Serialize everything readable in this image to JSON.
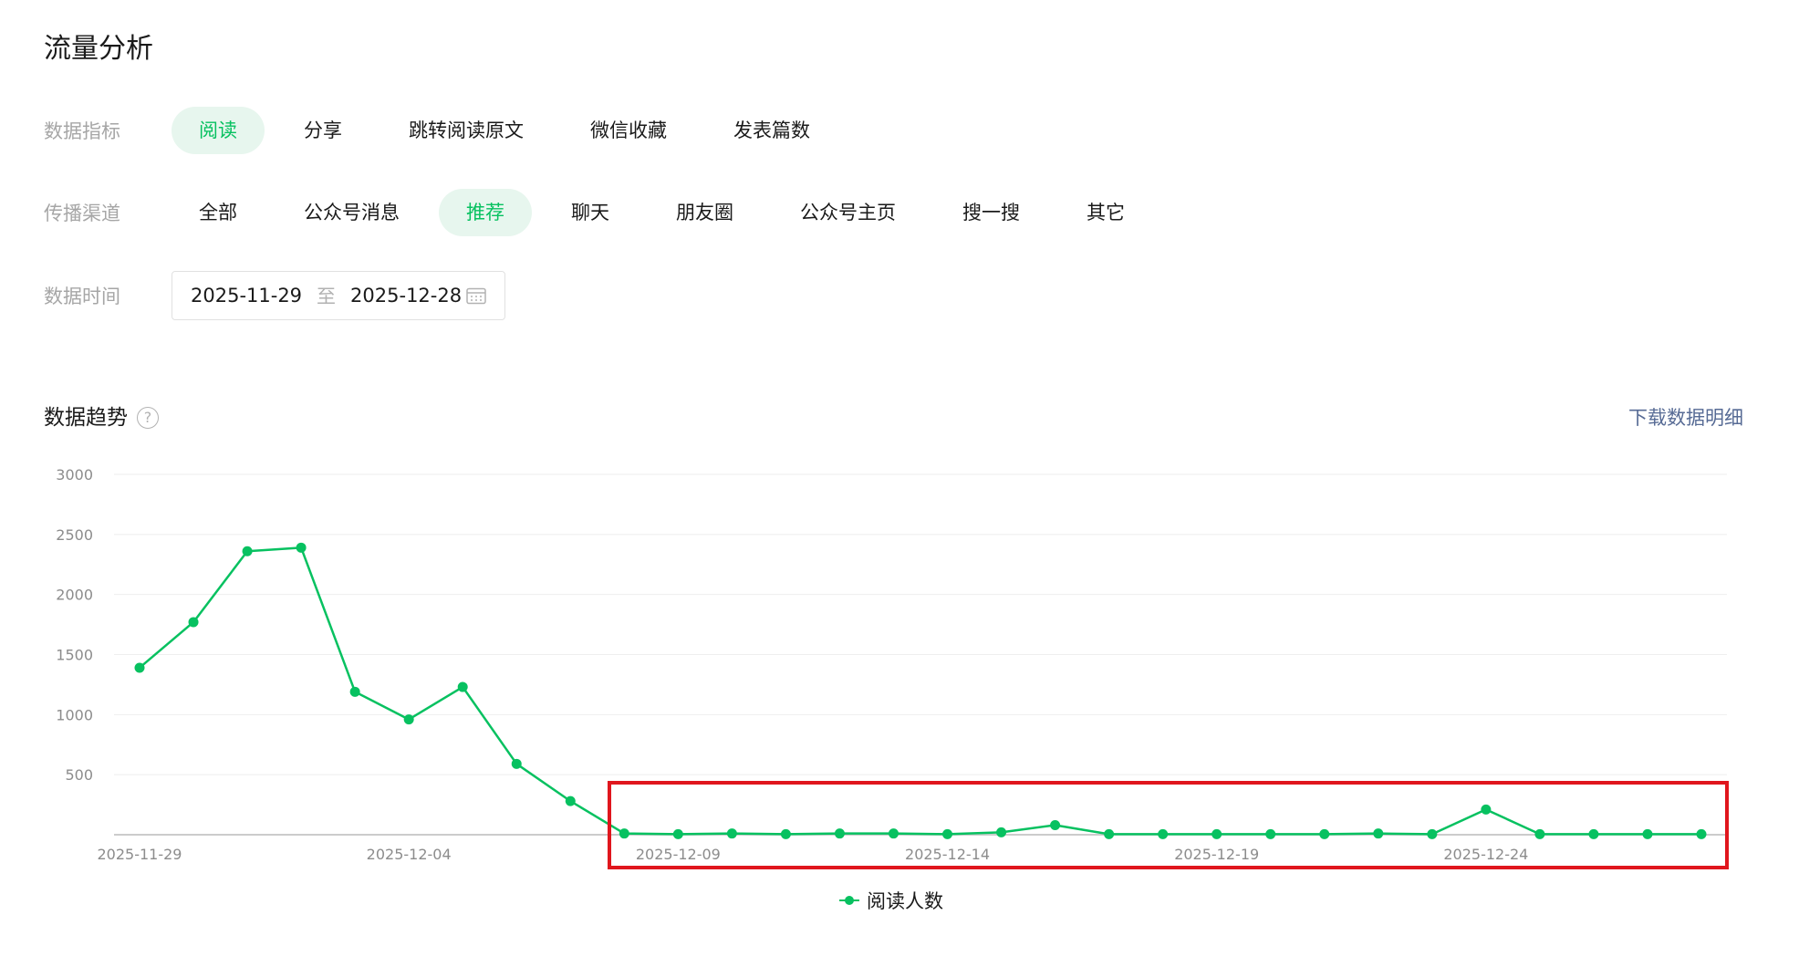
{
  "page": {
    "title": "流量分析"
  },
  "filters": {
    "metric": {
      "label": "数据指标",
      "options": [
        "阅读",
        "分享",
        "跳转阅读原文",
        "微信收藏",
        "发表篇数"
      ],
      "selected": "阅读"
    },
    "channel": {
      "label": "传播渠道",
      "options": [
        "全部",
        "公众号消息",
        "推荐",
        "聊天",
        "朋友圈",
        "公众号主页",
        "搜一搜",
        "其它"
      ],
      "selected": "推荐"
    },
    "date": {
      "label": "数据时间",
      "start": "2025-11-29",
      "separator": "至",
      "end": "2025-12-28"
    }
  },
  "trend": {
    "title": "数据趋势",
    "help": "?",
    "download_label": "下载数据明细"
  },
  "colors": {
    "accent": "#07c160",
    "accent_bg": "#e7f6ee",
    "link": "#576b95",
    "highlight": "#e0161d"
  },
  "chart_data": {
    "type": "line",
    "x": [
      "2025-11-29",
      "2025-11-30",
      "2025-12-01",
      "2025-12-02",
      "2025-12-03",
      "2025-12-04",
      "2025-12-05",
      "2025-12-06",
      "2025-12-07",
      "2025-12-08",
      "2025-12-09",
      "2025-12-10",
      "2025-12-11",
      "2025-12-12",
      "2025-12-13",
      "2025-12-14",
      "2025-12-15",
      "2025-12-16",
      "2025-12-17",
      "2025-12-18",
      "2025-12-19",
      "2025-12-20",
      "2025-12-21",
      "2025-12-22",
      "2025-12-23",
      "2025-12-24",
      "2025-12-25",
      "2025-12-26",
      "2025-12-27",
      "2025-12-28"
    ],
    "x_tick_labels": [
      "2025-11-29",
      "2025-12-04",
      "2025-12-09",
      "2025-12-14",
      "2025-12-19",
      "2025-12-24"
    ],
    "y_ticks": [
      500,
      1000,
      1500,
      2000,
      2500,
      3000
    ],
    "ylim": [
      0,
      3000
    ],
    "series": [
      {
        "name": "阅读人数",
        "values": [
          1390,
          1770,
          2360,
          2390,
          1190,
          960,
          1230,
          590,
          280,
          10,
          5,
          10,
          5,
          10,
          10,
          5,
          20,
          80,
          5,
          5,
          5,
          5,
          5,
          10,
          5,
          210,
          5,
          5,
          5,
          5
        ]
      }
    ],
    "legend_position": "bottom-center",
    "grid": true
  }
}
